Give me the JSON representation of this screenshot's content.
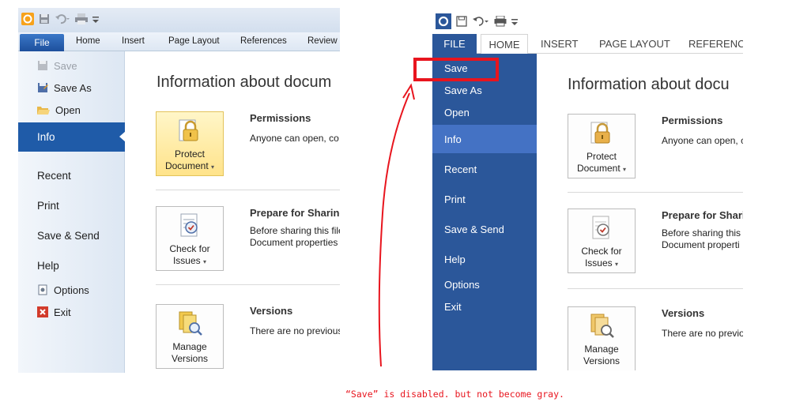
{
  "left_window": {
    "tabs": {
      "file": "File",
      "home": "Home",
      "insert": "Insert",
      "page_layout": "Page Layout",
      "references": "References",
      "review": "Review"
    },
    "backstage": {
      "save": "Save",
      "save_as": "Save As",
      "open": "Open",
      "info": "Info",
      "recent": "Recent",
      "print": "Print",
      "save_send": "Save & Send",
      "help": "Help",
      "options": "Options",
      "exit": "Exit"
    },
    "content": {
      "title": "Information about docum",
      "protect_line1": "Protect",
      "protect_line2": "Document",
      "permissions_title": "Permissions",
      "permissions_text": "Anyone can open, co",
      "check_line1": "Check for",
      "check_line2": "Issues",
      "prepare_title": "Prepare for Sharing",
      "prepare_text1": "Before sharing this file",
      "prepare_text2": "Document properties",
      "manage_line1": "Manage",
      "manage_line2": "Versions",
      "versions_title": "Versions",
      "versions_text": "There are no previous"
    }
  },
  "right_window": {
    "tabs": {
      "file": "FILE",
      "home": "HOME",
      "insert": "INSERT",
      "page_layout": "PAGE LAYOUT",
      "references": "REFERENCE"
    },
    "backstage": {
      "save": "Save",
      "save_as": "Save As",
      "open": "Open",
      "info": "Info",
      "recent": "Recent",
      "print": "Print",
      "save_send": "Save & Send",
      "help": "Help",
      "options": "Options",
      "exit": "Exit"
    },
    "content": {
      "title": "Information about docu",
      "protect_line1": "Protect",
      "protect_line2": "Document",
      "permissions_title": "Permissions",
      "permissions_text": "Anyone can open, c",
      "check_line1": "Check for",
      "check_line2": "Issues",
      "prepare_title": "Prepare for Shari",
      "prepare_text1": "Before sharing this f",
      "prepare_text2": "Document properti",
      "manage_line1": "Manage",
      "manage_line2": "Versions",
      "versions_title": "Versions",
      "versions_text": "There are no previo"
    }
  },
  "annotation": {
    "note": "“Save” is disabled. but not become gray.",
    "color": "#e8151e"
  },
  "colors": {
    "w2013_backstage": "#2b579a",
    "w2013_active": "#4472c4",
    "w2010_active": "#1f5ba8"
  }
}
